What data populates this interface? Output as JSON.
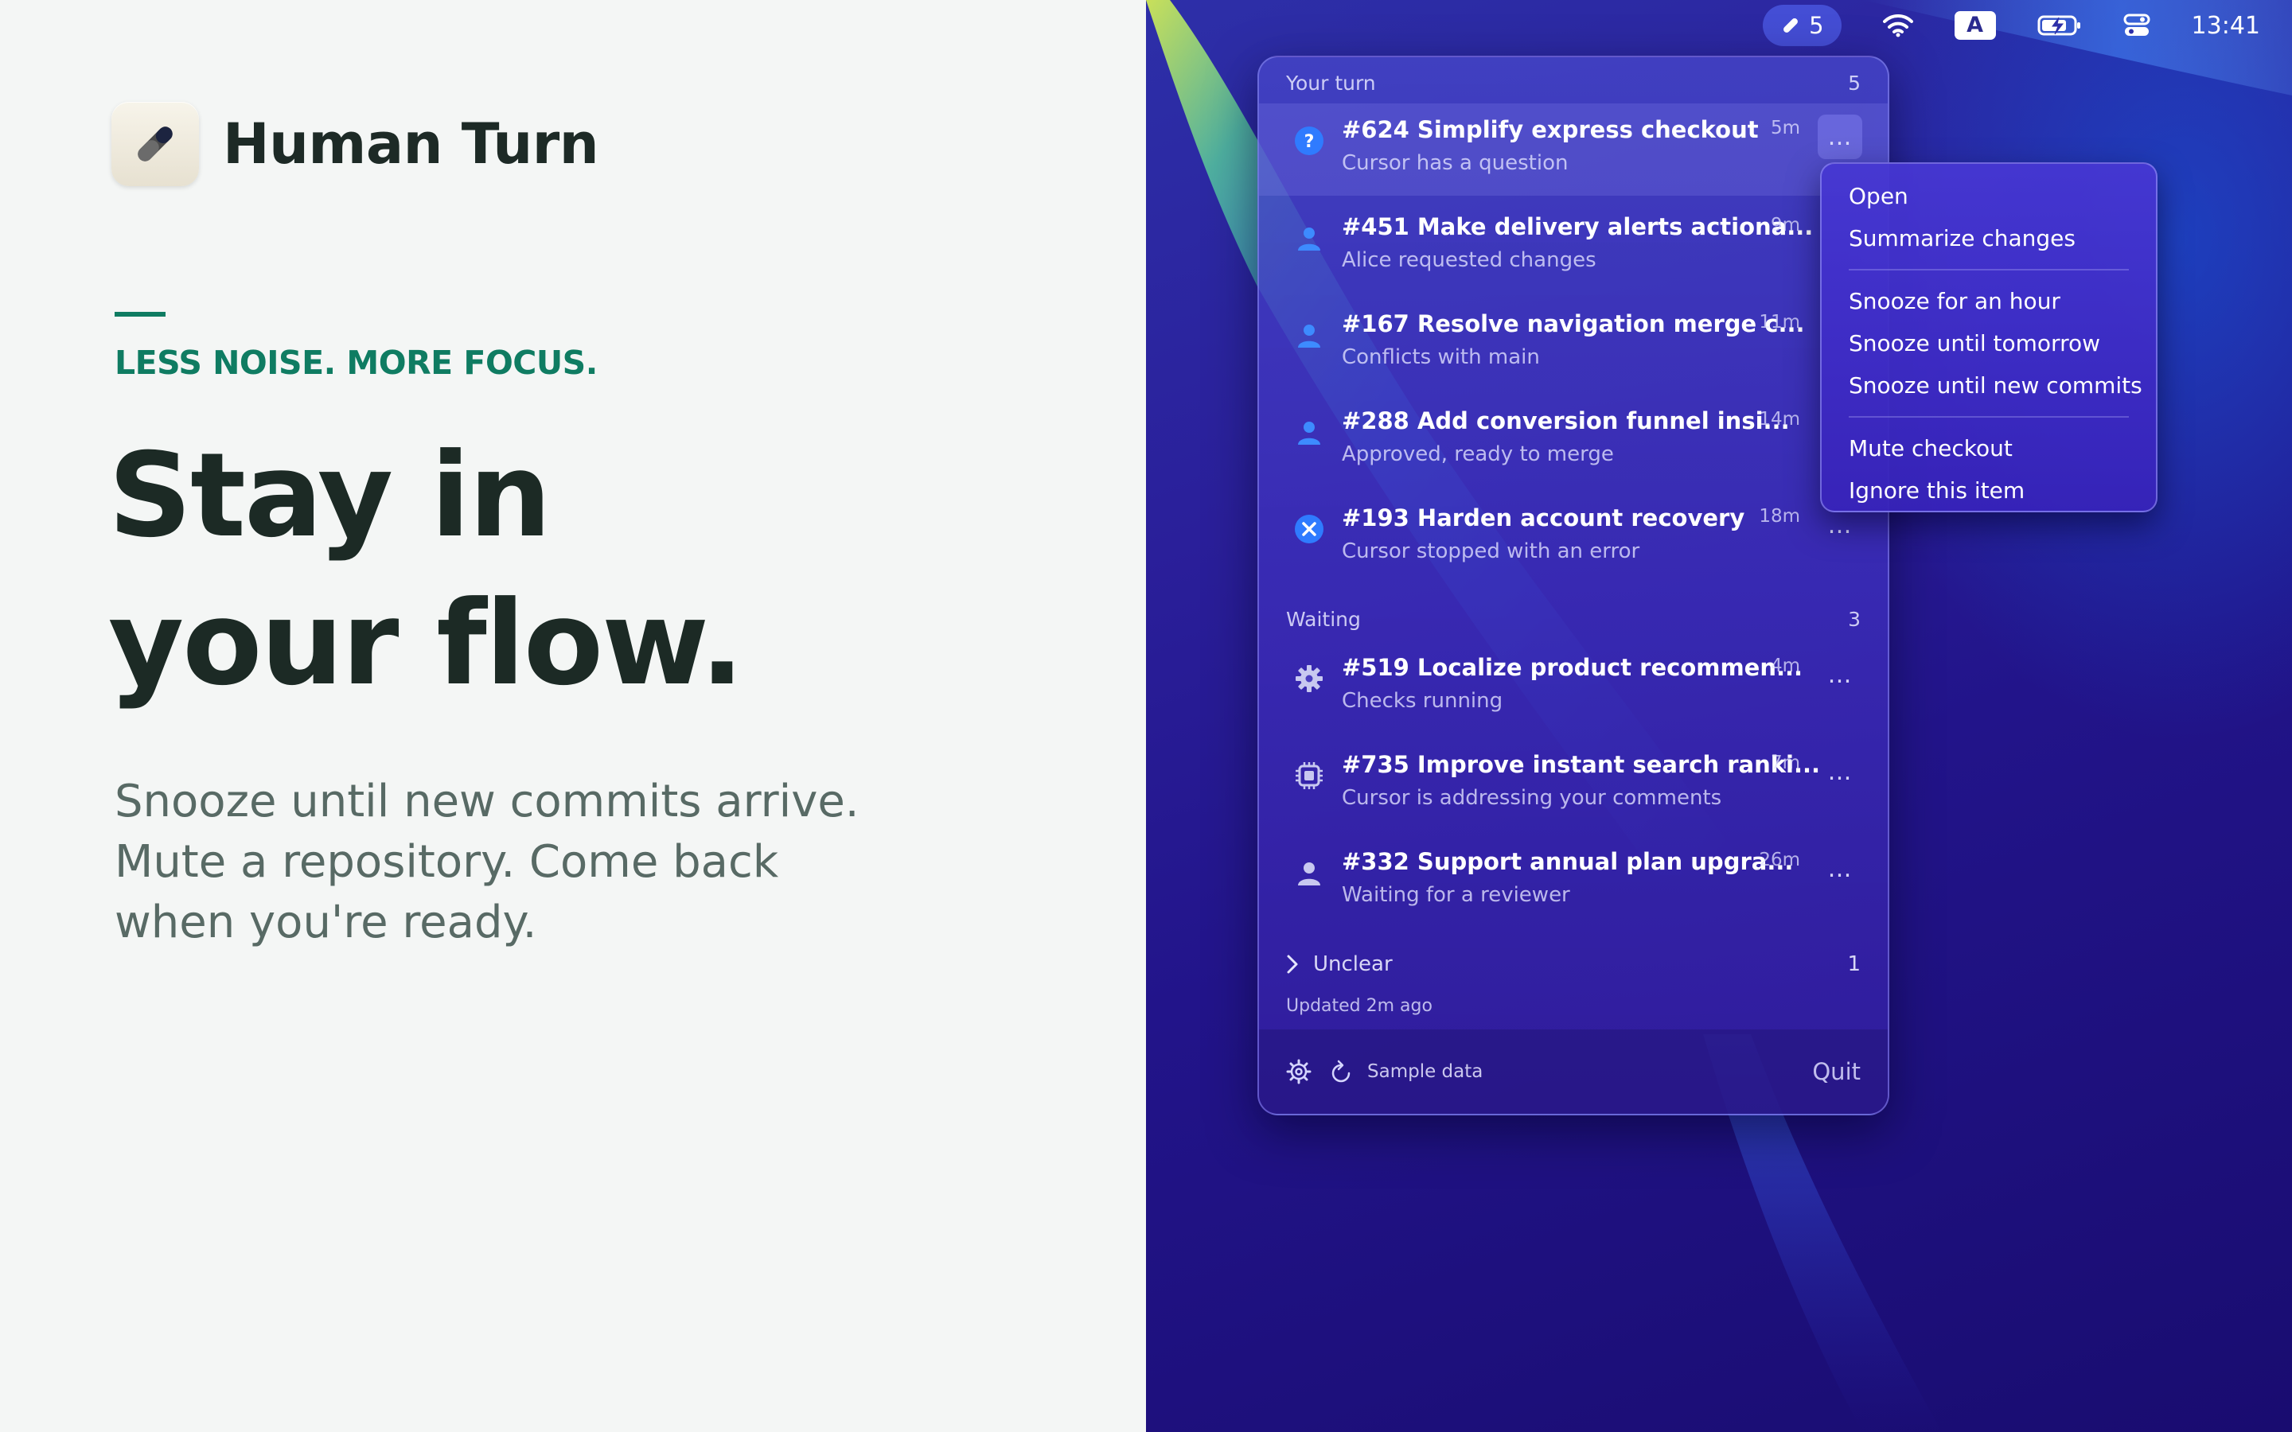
{
  "brand": {
    "name": "Human Turn",
    "icon": "pen-icon"
  },
  "tagline": "LESS NOISE. MORE FOCUS.",
  "headline": {
    "line1": "Stay in",
    "line2": "your flow."
  },
  "body_copy": {
    "line1": "Snooze until new commits arrive.",
    "line2": "Mute a repository. Come back",
    "line3": "when you're ready."
  },
  "menubar": {
    "badge_count": "5",
    "input_source": "A",
    "clock": "13:41"
  },
  "popover": {
    "your_turn": {
      "label": "Your turn",
      "count": "5",
      "items": [
        {
          "title": "#624 Simplify express checkout",
          "subtitle": "Cursor has a question",
          "time": "5m",
          "status": "question-icon"
        },
        {
          "title": "#451 Make delivery alerts actiona...",
          "subtitle": "Alice requested changes",
          "time": "9m",
          "status": "person-icon"
        },
        {
          "title": "#167 Resolve navigation merge c...",
          "subtitle": "Conflicts with main",
          "time": "11m",
          "status": "person-icon"
        },
        {
          "title": "#288 Add conversion funnel insi...",
          "subtitle": "Approved, ready to merge",
          "time": "14m",
          "status": "person-icon"
        },
        {
          "title": "#193 Harden account recovery",
          "subtitle": "Cursor stopped with an error",
          "time": "18m",
          "status": "error-icon"
        }
      ]
    },
    "waiting": {
      "label": "Waiting",
      "count": "3",
      "items": [
        {
          "title": "#519 Localize product recommen...",
          "subtitle": "Checks running",
          "time": "4m",
          "status": "gear-icon"
        },
        {
          "title": "#735 Improve instant search ranki...",
          "subtitle": "Cursor is addressing your comments",
          "time": "7m",
          "status": "chip-icon"
        },
        {
          "title": "#332 Support annual plan upgra...",
          "subtitle": "Waiting for a reviewer",
          "time": "26m",
          "status": "person-icon"
        }
      ]
    },
    "unclear": {
      "label": "Unclear",
      "count": "1"
    },
    "updated": "Updated 2m ago",
    "footer": {
      "sample_data": "Sample data",
      "quit": "Quit"
    },
    "more_glyph": "…"
  },
  "context_menu": {
    "items": [
      "Open",
      "Summarize changes",
      "Snooze for an hour",
      "Snooze until tomorrow",
      "Snooze until new commits",
      "Mute checkout",
      "Ignore this item"
    ]
  },
  "colors": {
    "accent_green": "#0f7c62",
    "status_blue": "#2f7bff",
    "desktop_purple": "#22148a"
  }
}
